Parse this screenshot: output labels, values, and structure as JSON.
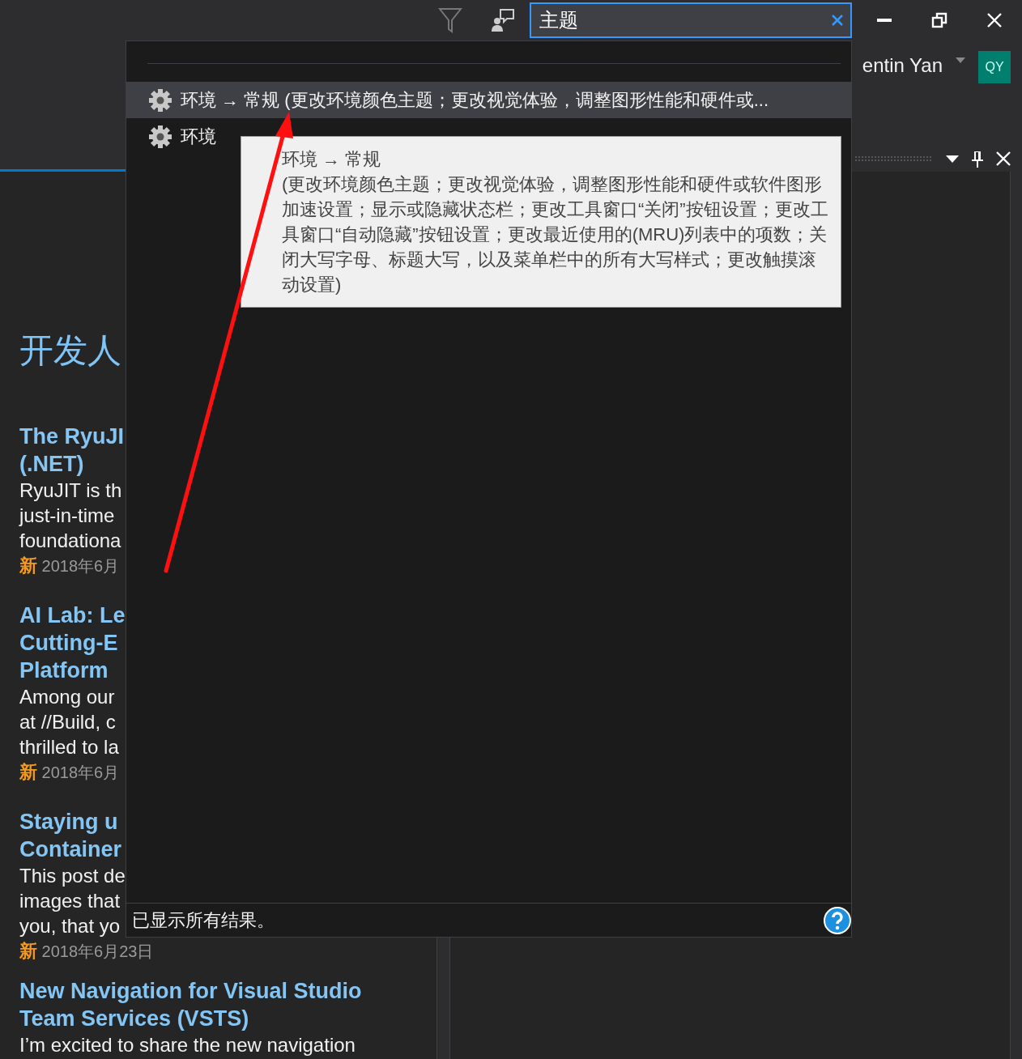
{
  "search": {
    "value": "主题"
  },
  "account": {
    "name": "entin Yan",
    "initials": "QY"
  },
  "start_page": {
    "heading": "开发人",
    "articles": [
      {
        "title_lines": [
          "The RyuJI",
          "(.NET)"
        ],
        "body_lines": [
          "RyuJIT is th",
          "just-in-time",
          "foundationa"
        ],
        "badge": "新",
        "date": "2018年6月"
      },
      {
        "title_lines": [
          "AI Lab: Le",
          "Cutting-E",
          "Platform"
        ],
        "body_lines": [
          "Among our",
          "at //Build, c",
          "thrilled to la"
        ],
        "badge": "新",
        "date": "2018年6月"
      },
      {
        "title_lines": [
          "Staying u",
          "Container"
        ],
        "body_lines": [
          "This post de",
          "images that",
          "you, that yo"
        ],
        "badge": "新",
        "date": "2018年6月23日"
      },
      {
        "title_lines": [
          "New Navigation for Visual Studio",
          "Team Services (VSTS)"
        ],
        "body_lines": [
          "I’m excited to share the new navigation"
        ]
      }
    ]
  },
  "quick_launch": {
    "results": [
      {
        "text": "环境 → 常规 (更改环境颜色主题；更改视觉体验，调整图形性能和硬件或...",
        "selected": true
      },
      {
        "text": "环境",
        "selected": false
      }
    ],
    "tooltip": {
      "title": "环境 → 常规",
      "description": "(更改环境颜色主题；更改视觉体验，调整图形性能和硬件或软件图形加速设置；显示或隐藏状态栏；更改工具窗口“关闭”按钮设置；更改工具窗口“自动隐藏”按钮设置；更改最近使用的(MRU)列表中的项数；关闭大写字母、标题大写，以及菜单栏中的所有大写样式；更改触摸滚动设置)"
    },
    "status": "已显示所有结果。"
  }
}
